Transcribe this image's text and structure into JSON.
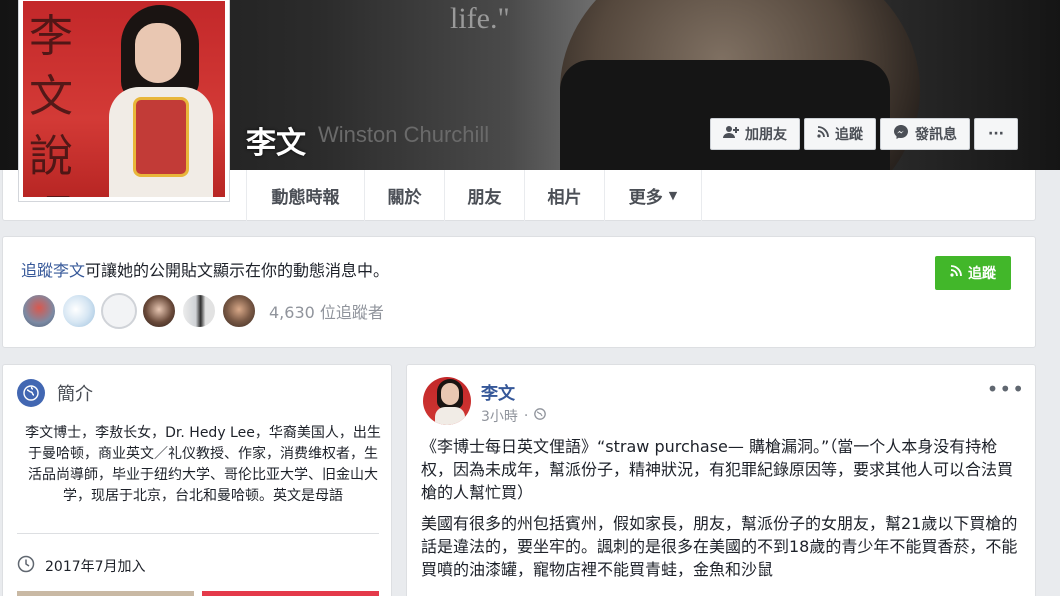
{
  "page": {
    "name": "李文",
    "cover_quote": "life.\"",
    "cover_credit": "Winston Churchill"
  },
  "cover_actions": [
    {
      "label": "加朋友",
      "icon": "add-friend-icon"
    },
    {
      "label": "追蹤",
      "icon": "rss-icon"
    },
    {
      "label": "發訊息",
      "icon": "messenger-icon"
    },
    {
      "label": "···",
      "icon": "more-icon"
    }
  ],
  "tabs": [
    {
      "label": "動態時報",
      "active": true
    },
    {
      "label": "關於"
    },
    {
      "label": "朋友"
    },
    {
      "label": "相片"
    },
    {
      "label": "更多",
      "dropdown": true
    }
  ],
  "follow_card": {
    "prompt_link": "追蹤李文",
    "prompt_rest": "可讓她的公開貼文顯示在你的動態消息中。",
    "button_label": "追蹤",
    "follower_count": "4,630 位追蹤者"
  },
  "intro": {
    "title": "簡介",
    "bio": "李文博士，李敖长女，Dr. Hedy Lee，华裔美国人，出生于曼哈顿，商业英文／礼仪教授、作家，消费维权者，生活品尚導師，毕业于纽约大学、哥伦比亚大学、旧金山大学，现居于北京，台北和曼哈顿。英文是母語",
    "joined": "2017年7月加入"
  },
  "post": {
    "author": "李文",
    "time": "3小時",
    "paragraph1": "《李博士每日英文俚語》“straw purchase— 購槍漏洞。”（當一个人本身没有持枪权，因為未成年，幫派份子，精神狀況，有犯罪紀錄原因等，要求其他人可以合法買槍的人幫忙買）",
    "paragraph2": "美國有很多的州包括賓州，假如家長，朋友，幫派份子的女朋友，幫21歲以下買槍的話是違法的，要坐牢的。諷刺的是很多在美國的不到18歲的青少年不能買香菸，不能買噴的油漆罐，寵物店裡不能買青蛙，金魚和沙鼠"
  },
  "colors": {
    "facebook_blue": "#4267b2",
    "link_blue": "#365899",
    "follow_green": "#42b72a",
    "page_bg": "#e9ebee"
  }
}
